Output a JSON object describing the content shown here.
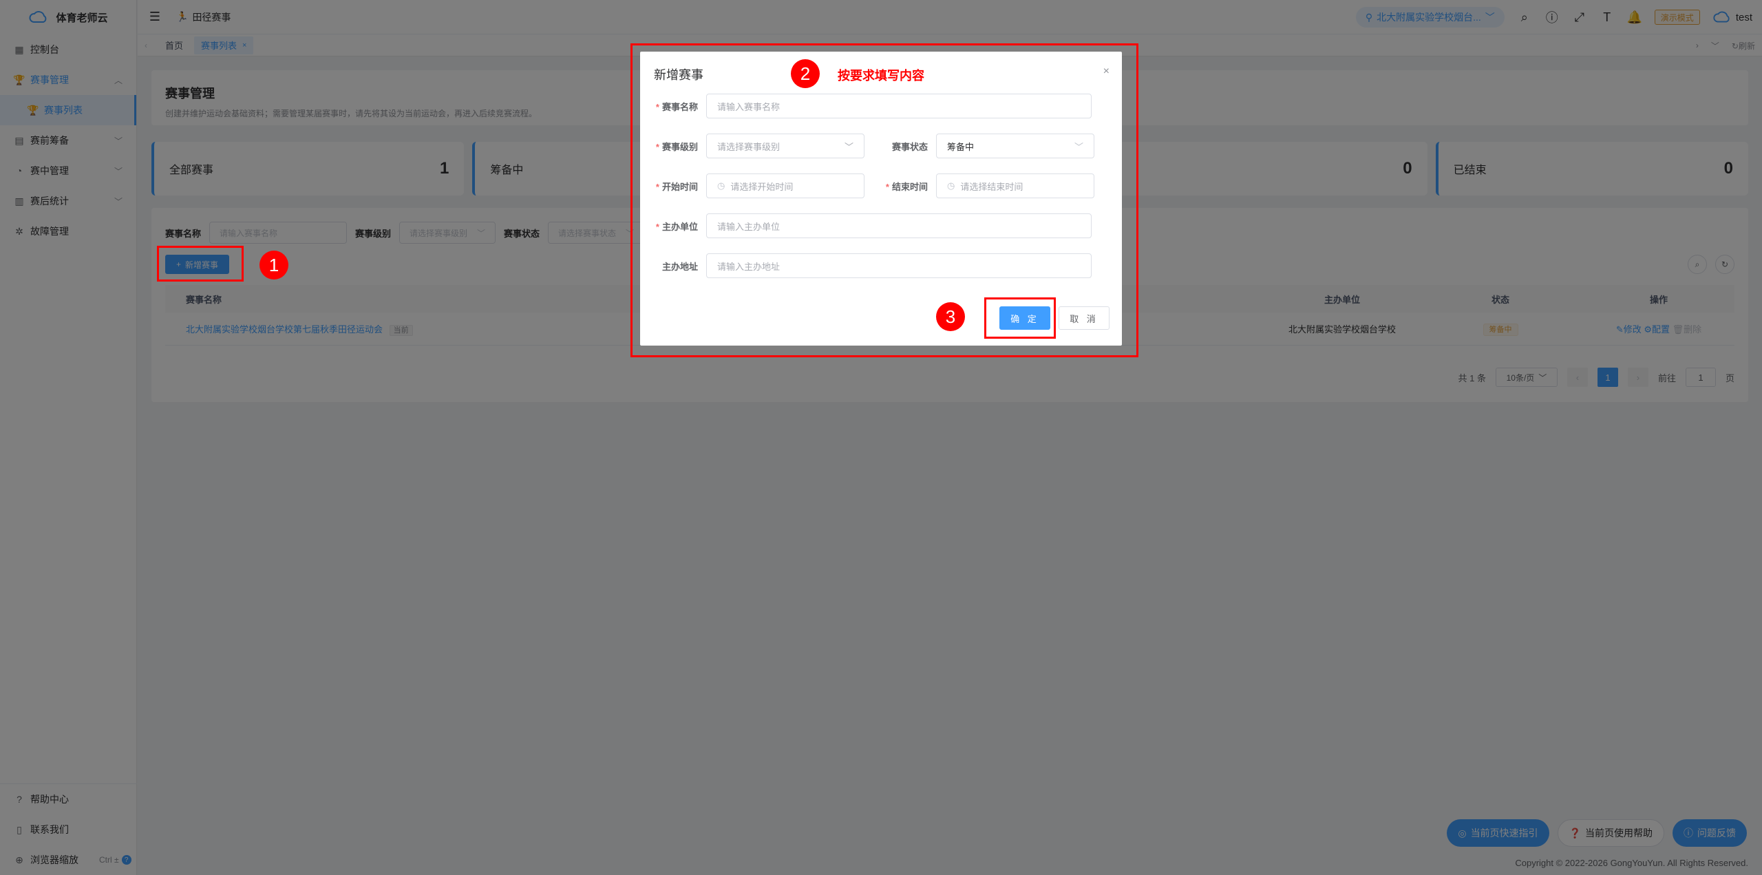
{
  "app": {
    "name": "体育老师云"
  },
  "sidebar": {
    "items": [
      {
        "label": "控制台",
        "icon": "dashboard-icon"
      },
      {
        "label": "赛事管理",
        "icon": "trophy-icon"
      },
      {
        "label": "赛事列表",
        "icon": "trophy-icon"
      },
      {
        "label": "赛前筹备",
        "icon": "clipboard-icon"
      },
      {
        "label": "赛中管理",
        "icon": "gauge-icon"
      },
      {
        "label": "赛后统计",
        "icon": "chart-icon"
      },
      {
        "label": "故障管理",
        "icon": "bug-icon"
      }
    ],
    "bottom": {
      "help": "帮助中心",
      "contact": "联系我们",
      "zoom": "浏览器缩放",
      "zoom_kbd": "Ctrl ±"
    }
  },
  "topbar": {
    "page": "田径赛事",
    "school": "北大附属实验学校烟台...",
    "mode": "演示模式",
    "user": "test"
  },
  "tags": {
    "home": "首页",
    "current": "赛事列表",
    "refresh": "刷新"
  },
  "header": {
    "title": "赛事管理",
    "desc": "创建并维护运动会基础资料；需要管理某届赛事时，请先将其设为当前运动会，再进入后续竞赛流程。"
  },
  "stats": [
    {
      "label": "全部赛事",
      "value": "1"
    },
    {
      "label": "筹备中",
      "value": ""
    },
    {
      "label": "",
      "value": ""
    },
    {
      "label": "",
      "value": "0"
    },
    {
      "label": "已结束",
      "value": "0"
    }
  ],
  "filters": {
    "name_label": "赛事名称",
    "name_placeholder": "请输入赛事名称",
    "level_label": "赛事级别",
    "level_placeholder": "请选择赛事级别",
    "status_label": "赛事状态",
    "status_placeholder": "请选择赛事状态",
    "add_button": "新增赛事"
  },
  "table": {
    "headers": {
      "name": "赛事名称",
      "org": "主办单位",
      "status": "状态",
      "op": "操作"
    },
    "rows": [
      {
        "name": "北大附属实验学校烟台学校第七届秋季田径运动会",
        "current_tag": "当前",
        "org": "北大附属实验学校烟台学校",
        "status": "筹备中",
        "op_edit": "修改",
        "op_config": "配置",
        "op_delete": "删除"
      }
    ]
  },
  "pager": {
    "total": "共 1 条",
    "size": "10条/页",
    "page": "1",
    "goto_label": "前往",
    "goto_value": "1",
    "unit": "页"
  },
  "dialog": {
    "title": "新增赛事",
    "name_label": "赛事名称",
    "name_placeholder": "请输入赛事名称",
    "level_label": "赛事级别",
    "level_placeholder": "请选择赛事级别",
    "status_label": "赛事状态",
    "status_value": "筹备中",
    "start_label": "开始时间",
    "start_placeholder": "请选择开始时间",
    "end_label": "结束时间",
    "end_placeholder": "请选择结束时间",
    "org_label": "主办单位",
    "org_placeholder": "请输入主办单位",
    "addr_label": "主办地址",
    "addr_placeholder": "请输入主办地址",
    "ok": "确 定",
    "cancel": "取 消"
  },
  "annotations": {
    "step1": "1",
    "step2": "2",
    "step2_text": "按要求填写内容",
    "step3": "3"
  },
  "floats": {
    "guide": "当前页快速指引",
    "help": "当前页使用帮助",
    "feedback": "问题反馈"
  },
  "footer": {
    "copyright": "Copyright © 2022-2026 GongYouYun. All Rights Reserved."
  },
  "colors": {
    "primary": "#409eff",
    "annotation": "#ff0000",
    "warning": "#e6a23c"
  }
}
